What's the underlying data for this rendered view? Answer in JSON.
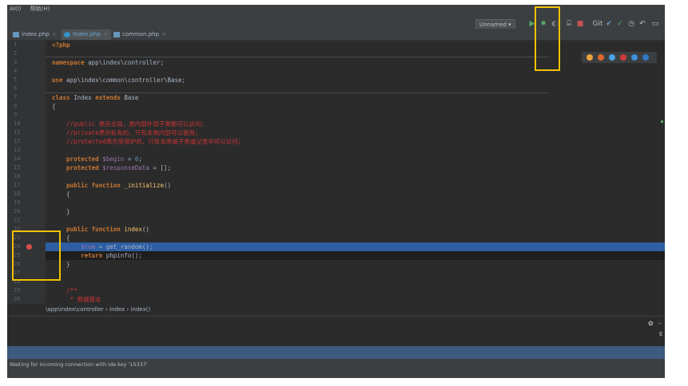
{
  "menubar": {
    "items": [
      "AI(I)",
      "帮助(H)"
    ]
  },
  "toolbar": {
    "run_config": "Unnamed ▾",
    "git_label": "Git"
  },
  "tabs": [
    {
      "label": "index.php",
      "active": false
    },
    {
      "label": "Index.php",
      "active": true
    },
    {
      "label": "common.php",
      "active": false
    }
  ],
  "editor": {
    "line_numbers": [
      "1",
      "2",
      "3",
      "4",
      "5",
      "6",
      "7",
      "8",
      "9",
      "10",
      "11",
      "12",
      "13",
      "14",
      "15",
      "16",
      "17",
      "18",
      "19",
      "20",
      "21",
      "22",
      "23",
      "24",
      "25",
      "26",
      "27",
      "28",
      "29",
      "30"
    ],
    "lines": [
      [
        {
          "t": "<?php",
          "c": "kw"
        }
      ],
      [],
      [
        {
          "t": "namespace ",
          "c": "kw"
        },
        {
          "t": "app\\index\\controller;",
          "c": "ns"
        }
      ],
      [],
      [
        {
          "t": "use ",
          "c": "kw"
        },
        {
          "t": "app\\index\\common\\controller\\Base;",
          "c": "ns"
        }
      ],
      [],
      [
        {
          "t": "class ",
          "c": "kw"
        },
        {
          "t": "Index ",
          "c": "plain"
        },
        {
          "t": "extends ",
          "c": "kw"
        },
        {
          "t": "Base",
          "c": "plain"
        }
      ],
      [
        {
          "t": "{",
          "c": "plain"
        }
      ],
      [],
      [
        {
          "t": "    //public 表示全局，类内部外部子类都可以访问；",
          "c": "cm"
        }
      ],
      [
        {
          "t": "    //private表示私有的，只有本类内部可以使用；",
          "c": "cm"
        }
      ],
      [
        {
          "t": "    //protected表示受保护的，只有本类或子类或父类中可以访问；",
          "c": "cm"
        }
      ],
      [],
      [
        {
          "t": "    protected ",
          "c": "kw"
        },
        {
          "t": "$begin",
          "c": "var"
        },
        {
          "t": " = ",
          "c": "plain"
        },
        {
          "t": "6",
          "c": "num"
        },
        {
          "t": ";",
          "c": "plain"
        }
      ],
      [
        {
          "t": "    protected ",
          "c": "kw"
        },
        {
          "t": "$responseData",
          "c": "var"
        },
        {
          "t": " = [];",
          "c": "plain"
        }
      ],
      [],
      [
        {
          "t": "    public function ",
          "c": "kw"
        },
        {
          "t": "_initialize",
          "c": "fn"
        },
        {
          "t": "()",
          "c": "plain"
        }
      ],
      [
        {
          "t": "    {",
          "c": "plain"
        }
      ],
      [],
      [
        {
          "t": "    }",
          "c": "plain"
        }
      ],
      [],
      [
        {
          "t": "    public function ",
          "c": "kw"
        },
        {
          "t": "index",
          "c": "fn"
        },
        {
          "t": "()",
          "c": "plain"
        }
      ],
      [
        {
          "t": "    {",
          "c": "plain"
        }
      ],
      [
        {
          "t": "        $com",
          "c": "var"
        },
        {
          "t": " = get_random();",
          "c": "plain"
        }
      ],
      [
        {
          "t": "        return ",
          "c": "kw"
        },
        {
          "t": "phpinfo();",
          "c": "plain"
        }
      ],
      [
        {
          "t": "    }",
          "c": "plain"
        }
      ],
      [],
      [],
      [
        {
          "t": "    /**",
          "c": "cm"
        }
      ],
      [
        {
          "t": "     * 数据基本",
          "c": "cm"
        }
      ]
    ]
  },
  "breadcrumb": {
    "text": "\\app\\index\\controller  ›  Index  ›  index()"
  },
  "statusbar": {
    "text": "Waiting for incoming connection with ide key '15337'"
  },
  "bottompanel": {
    "gear": "✿",
    "minus": "–",
    "e": "E"
  },
  "browsers": [
    "chrome",
    "firefox",
    "safari",
    "opera",
    "ie",
    "edge"
  ]
}
